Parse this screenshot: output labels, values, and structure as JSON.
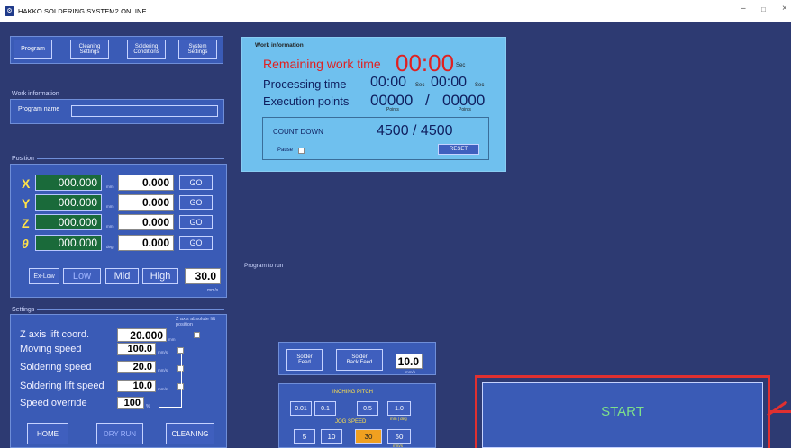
{
  "window": {
    "title": "HAKKO SOLDERING SYSTEM2 ONLINE....",
    "minimize": "–",
    "maximize": "□",
    "close": "×"
  },
  "nav": [
    "Program",
    "Cleaning\nSettings",
    "Soldering\nConditions",
    "System\nSettings"
  ],
  "work_info_section": {
    "header": "Work information",
    "program_name_label": "Program name",
    "program_name_value": ""
  },
  "position": {
    "header": "Position",
    "axes": [
      {
        "axis": "X",
        "current": "000.000",
        "unit": "mm",
        "target": "0.000",
        "go": "GO"
      },
      {
        "axis": "Y",
        "current": "000.000",
        "unit": "mm",
        "target": "0.000",
        "go": "GO"
      },
      {
        "axis": "Z",
        "current": "000.000",
        "unit": "mm",
        "target": "0.000",
        "go": "GO"
      },
      {
        "axis": "θ",
        "current": "000.000",
        "unit": "deg",
        "target": "0.000",
        "go": "GO"
      }
    ],
    "speeds": [
      "Ex-Low",
      "Low",
      "Mid",
      "High"
    ],
    "speed_value": "30.0",
    "speed_unit": "mm/s"
  },
  "settings": {
    "header": "Settings",
    "z_lift_label": "Z axis lift coord.",
    "z_lift_value": "20.000",
    "z_lift_unit": "mm",
    "z_abs_label": "Z axis absolute lift position",
    "moving_label": "Moving speed",
    "moving_value": "100.0",
    "moving_unit": "mm/s",
    "soldering_label": "Soldering speed",
    "soldering_value": "20.0",
    "soldering_unit": "mm/s",
    "lift_label": "Soldering lift speed",
    "lift_value": "10.0",
    "lift_unit": "mm/s",
    "override_label": "Speed override",
    "override_value": "100",
    "override_unit": "%"
  },
  "bottom_buttons": {
    "home": "HOME",
    "dry_run": "DRY RUN",
    "cleaning": "CLEANING"
  },
  "work_info_panel": {
    "header": "Work information",
    "remaining_label": "Remaining work time",
    "remaining_value": "00:00",
    "remaining_unit": "Sec",
    "processing_label": "Processing time",
    "processing_value1": "00:00",
    "processing_unit1": "Sec",
    "processing_value2": "00:00",
    "processing_unit2": "Sec",
    "exec_label": "Execution points",
    "exec_value1": "00000",
    "exec_slash": "/",
    "exec_value2": "00000",
    "exec_unit": "Points",
    "countdown_label": "COUNT DOWN",
    "countdown_value": "4500 / 4500",
    "pause_label": "Pause",
    "reset_label": "RESET"
  },
  "program_to_run": "Program to run",
  "solder": {
    "feed": "Solder\nFeed",
    "back_feed": "Solder\nBack Feed",
    "value": "10.0",
    "unit": "mm/s"
  },
  "inching": {
    "header": "INCHING PITCH",
    "values": [
      "0.01",
      "0.1",
      "0.5",
      "1.0"
    ],
    "unit": "mm | deg"
  },
  "jog": {
    "header": "JOG SPEED",
    "values": [
      "5",
      "10",
      "30",
      "50"
    ],
    "selected": "30",
    "unit": "mm/s"
  },
  "start": {
    "label": "START"
  },
  "colors": {
    "background": "#2d3a72",
    "panel": "#3a5bb6",
    "info_panel": "#6fc0ee",
    "accent_red": "#e02020",
    "start_border": "#e03030",
    "start_text": "#7ee08a",
    "jog_selected": "#f0a020"
  }
}
